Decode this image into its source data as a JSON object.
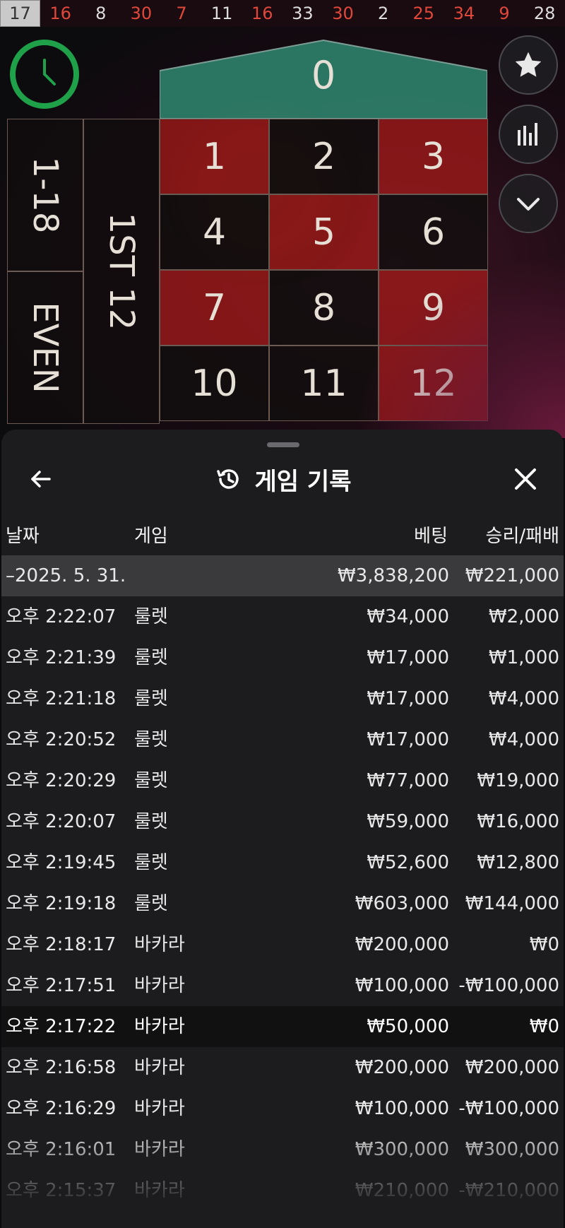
{
  "history_numbers": [
    {
      "n": "17",
      "red": false
    },
    {
      "n": "16",
      "red": true
    },
    {
      "n": "8",
      "red": false
    },
    {
      "n": "30",
      "red": true
    },
    {
      "n": "7",
      "red": true
    },
    {
      "n": "11",
      "red": false
    },
    {
      "n": "16",
      "red": true
    },
    {
      "n": "33",
      "red": false
    },
    {
      "n": "30",
      "red": true
    },
    {
      "n": "2",
      "red": false
    },
    {
      "n": "25",
      "red": true
    },
    {
      "n": "34",
      "red": true
    },
    {
      "n": "9",
      "red": true
    },
    {
      "n": "28",
      "red": false
    }
  ],
  "table": {
    "zero": "0",
    "numbers": [
      {
        "n": "1",
        "color": "red"
      },
      {
        "n": "2",
        "color": "black"
      },
      {
        "n": "3",
        "color": "red"
      },
      {
        "n": "4",
        "color": "black"
      },
      {
        "n": "5",
        "color": "red"
      },
      {
        "n": "6",
        "color": "black"
      },
      {
        "n": "7",
        "color": "red"
      },
      {
        "n": "8",
        "color": "black"
      },
      {
        "n": "9",
        "color": "red"
      },
      {
        "n": "10",
        "color": "black"
      },
      {
        "n": "11",
        "color": "black"
      },
      {
        "n": "12",
        "color": "red"
      }
    ],
    "low_bet": "1-18",
    "even_bet": "EVEN",
    "dozen_bet": "1ST 12"
  },
  "colors": {
    "accent_green": "#1fa14a",
    "zero_green": "#2f8a72",
    "red_cell": "#a01919"
  },
  "sheet": {
    "title": "게임 기록",
    "columns": {
      "date": "날짜",
      "game": "게임",
      "bet": "베팅",
      "win": "승리/패배"
    },
    "summary": {
      "date": "–2025. 5. 31.",
      "bet": "₩3,838,200",
      "win": "₩221,000"
    },
    "rows": [
      {
        "date": "오후 2:22:07",
        "game": "룰렛",
        "bet": "₩34,000",
        "win": "₩2,000"
      },
      {
        "date": "오후 2:21:39",
        "game": "룰렛",
        "bet": "₩17,000",
        "win": "₩1,000"
      },
      {
        "date": "오후 2:21:18",
        "game": "룰렛",
        "bet": "₩17,000",
        "win": "₩4,000"
      },
      {
        "date": "오후 2:20:52",
        "game": "룰렛",
        "bet": "₩17,000",
        "win": "₩4,000"
      },
      {
        "date": "오후 2:20:29",
        "game": "룰렛",
        "bet": "₩77,000",
        "win": "₩19,000"
      },
      {
        "date": "오후 2:20:07",
        "game": "룰렛",
        "bet": "₩59,000",
        "win": "₩16,000"
      },
      {
        "date": "오후 2:19:45",
        "game": "룰렛",
        "bet": "₩52,600",
        "win": "₩12,800"
      },
      {
        "date": "오후 2:19:18",
        "game": "룰렛",
        "bet": "₩603,000",
        "win": "₩144,000"
      },
      {
        "date": "오후 2:18:17",
        "game": "바카라",
        "bet": "₩200,000",
        "win": "₩0"
      },
      {
        "date": "오후 2:17:51",
        "game": "바카라",
        "bet": "₩100,000",
        "win": "-₩100,000"
      },
      {
        "date": "오후 2:17:22",
        "game": "바카라",
        "bet": "₩50,000",
        "win": "₩0"
      },
      {
        "date": "오후 2:16:58",
        "game": "바카라",
        "bet": "₩200,000",
        "win": "₩200,000"
      },
      {
        "date": "오후 2:16:29",
        "game": "바카라",
        "bet": "₩100,000",
        "win": "-₩100,000"
      },
      {
        "date": "오후 2:16:01",
        "game": "바카라",
        "bet": "₩300,000",
        "win": "₩300,000"
      },
      {
        "date": "오후 2:15:37",
        "game": "바카라",
        "bet": "₩210,000",
        "win": "-₩210,000"
      }
    ],
    "highlighted_row_index": 10
  }
}
